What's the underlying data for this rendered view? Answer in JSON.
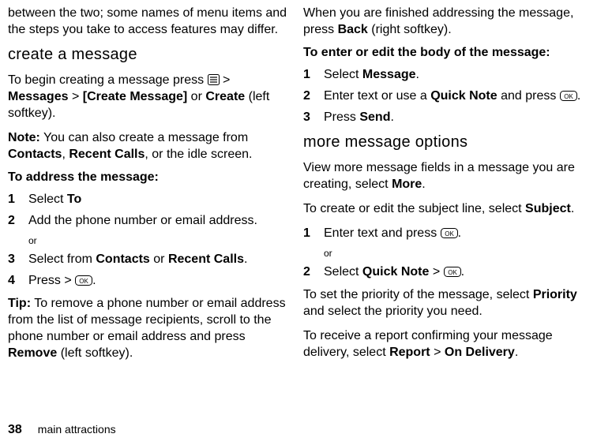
{
  "left": {
    "intro": "between the two; some names of menu items and the steps you take to access features may differ.",
    "create_heading": "create a message",
    "create_p1_a": "To begin creating a message press ",
    "create_p1_b": " > ",
    "create_messages": "Messages",
    "create_gt1": " > ",
    "create_create_message": "[Create Message]",
    "create_or": " or ",
    "create_create": "Create",
    "create_softkey": " (left softkey).",
    "note_label": "Note:",
    "note_text_a": " You can also create a message from ",
    "note_contacts": "Contacts",
    "note_comma": ", ",
    "note_recent": "Recent Calls",
    "note_rest": ", or the idle screen.",
    "addr_heading": "To address the message:",
    "step1_a": "Select ",
    "step1_to": "To",
    "step2": "Add the phone number or email address.",
    "or": "or",
    "step3_a": "Select from ",
    "step3_contacts": "Contacts",
    "step3_or": " or ",
    "step3_recent": "Recent Calls",
    "step3_dot": ".",
    "step4_a": "Press > ",
    "step4_dot": ".",
    "tip_label": "Tip:",
    "tip_text_a": " To remove a phone number or email address from the list of message recipients, scroll to the phone number or email address and press ",
    "tip_remove": "Remove",
    "tip_softkey": " (left softkey)."
  },
  "right": {
    "top_a": "When you are finished addressing the message, press ",
    "top_back": "Back",
    "top_b": " (right softkey).",
    "enter_heading": "To enter or edit the body of the message:",
    "r1_a": "Select ",
    "r1_msg": "Message",
    "r1_dot": ".",
    "r2_a": "Enter text or use a ",
    "r2_qn": "Quick Note",
    "r2_b": " and press ",
    "r2_dot": ".",
    "r3_a": "Press ",
    "r3_send": "Send",
    "r3_dot": ".",
    "more_heading": "more message options",
    "more_p1_a": "View more message fields in a message you are creating, select ",
    "more_p1_more": "More",
    "more_p1_dot": ".",
    "more_p2_a": "To create or edit the subject line, select ",
    "more_p2_subj": "Subject",
    "more_p2_dot": ".",
    "m1_a": "Enter text and press ",
    "m1_dot": ".",
    "or": "or",
    "m2_a": "Select ",
    "m2_qn": "Quick Note",
    "m2_gt": " > ",
    "m2_dot": ".",
    "prio_a": "To set the priority of the message, select ",
    "prio_b": "Priority",
    "prio_c": " and select the priority you need.",
    "report_a": "To receive a report confirming your message delivery, select ",
    "report_b": "Report",
    "report_gt": " > ",
    "report_c": "On Delivery",
    "report_dot": "."
  },
  "footer": {
    "page": "38",
    "section": "main attractions"
  }
}
